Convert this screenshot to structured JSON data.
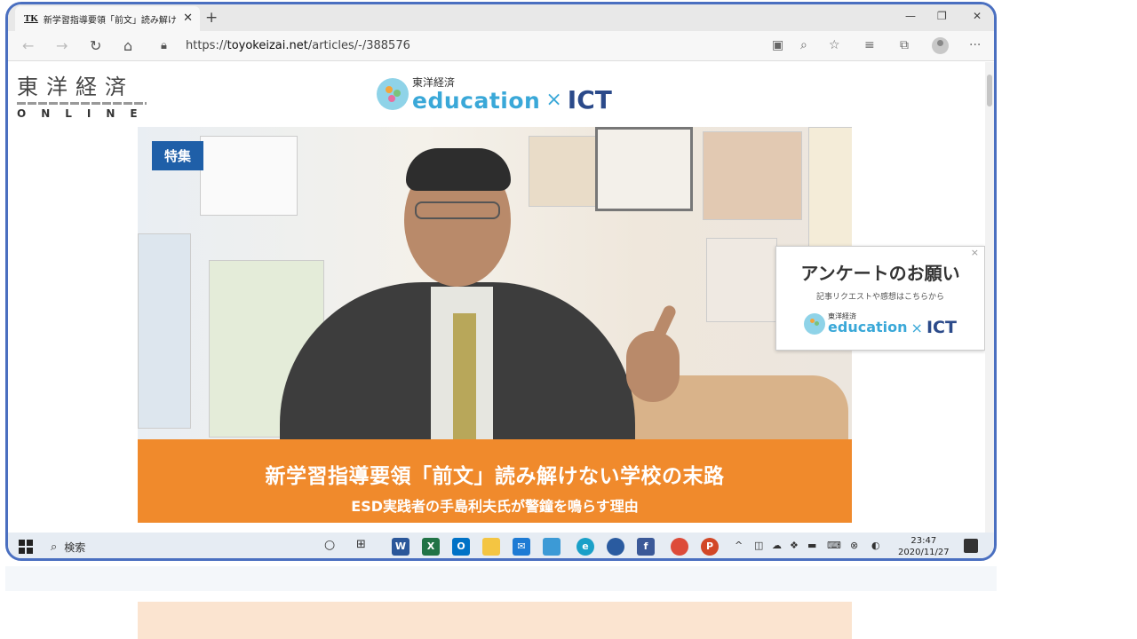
{
  "browser": {
    "tab_favicon": "TK",
    "tab_title": "新学習指導要領「前文」読み解けな",
    "tab_close": "✕",
    "new_tab": "+",
    "url_scheme": "https://",
    "url_host": "toyokeizai.net",
    "url_path": "/articles/-/388576",
    "window_buttons": [
      "—",
      "❐",
      "✕"
    ]
  },
  "site": {
    "logo_kanji": "東洋経済",
    "logo_online": "ONLINE",
    "brand_small": "東洋経済",
    "brand_main": "education",
    "brand_x": "×",
    "brand_ict": "ICT"
  },
  "hero": {
    "badge": "特集",
    "title": "新学習指導要領「前文」読み解けない学校の末路",
    "subtitle": "ESD実践者の手島利夫氏が警鐘を鳴らす理由"
  },
  "survey": {
    "close": "×",
    "title": "アンケートのお願い",
    "subtitle": "記事リクエストや感想はこちらから",
    "brand_small": "東洋経済",
    "brand_main": "education",
    "brand_x": "×",
    "brand_ict": "ICT"
  },
  "taskbar": {
    "search_placeholder": "検索",
    "time": "23:47",
    "date": "2020/11/27"
  },
  "colors": {
    "frame_border": "#4a6fc0",
    "hero_caption": "#f08a2c",
    "badge": "#1f5fa8",
    "brand_blue": "#3aa8d8",
    "ict_navy": "#2b4a8a"
  }
}
